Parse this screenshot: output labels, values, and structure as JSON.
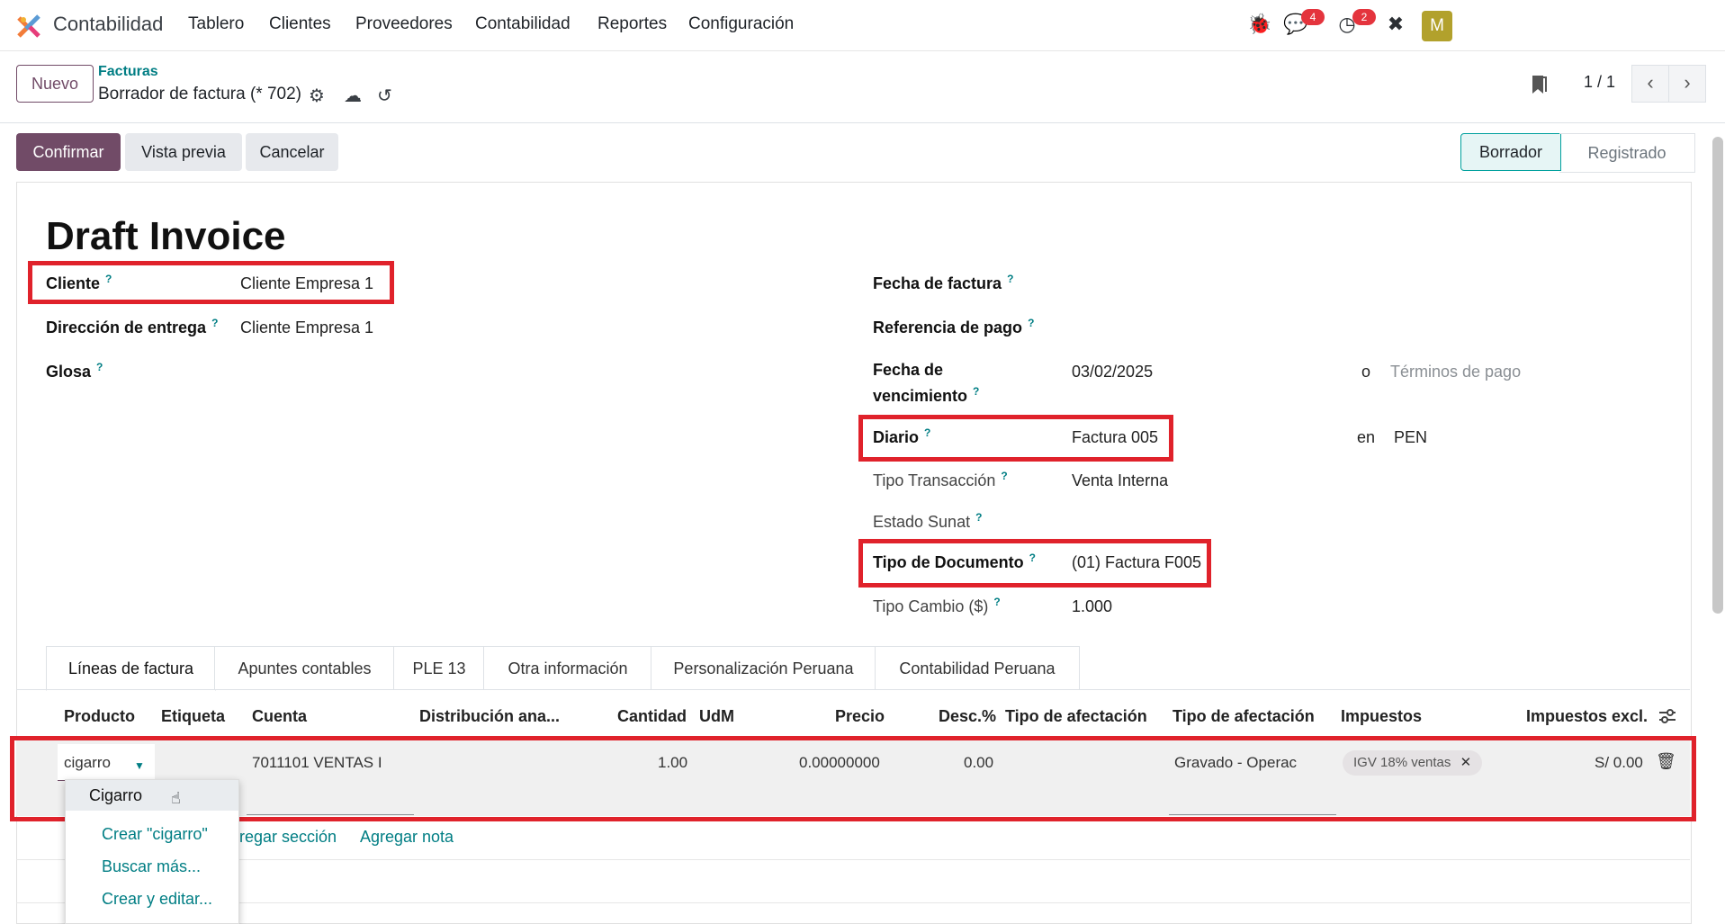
{
  "app": {
    "name": "Contabilidad",
    "menu": [
      "Tablero",
      "Clientes",
      "Proveedores",
      "Contabilidad",
      "Reportes",
      "Configuración"
    ],
    "messages_badge": "4",
    "activities_badge": "2",
    "avatar_initial": "M"
  },
  "control_panel": {
    "new_label": "Nuevo",
    "breadcrumb_parent": "Facturas",
    "breadcrumb_current": "Borrador de factura (* 702)",
    "pager": "1 / 1"
  },
  "actions": {
    "confirm": "Confirmar",
    "preview": "Vista previa",
    "cancel": "Cancelar"
  },
  "status": {
    "current": "Borrador",
    "next": "Registrado"
  },
  "form": {
    "title": "Draft Invoice",
    "left": {
      "cliente_label": "Cliente",
      "cliente_value": "Cliente Empresa 1",
      "direccion_label": "Dirección de entrega",
      "direccion_value": "Cliente Empresa 1",
      "glosa_label": "Glosa"
    },
    "right": {
      "fecha_factura_label": "Fecha de factura",
      "referencia_label": "Referencia de pago",
      "vencimiento_label_1": "Fecha de",
      "vencimiento_label_2": "vencimiento",
      "vencimiento_value": "03/02/2025",
      "or_label": "o",
      "terminos_placeholder": "Términos de pago",
      "diario_label": "Diario",
      "diario_value": "Factura 005",
      "en_label": "en",
      "currency": "PEN",
      "tipo_transaccion_label": "Tipo Transacción",
      "tipo_transaccion_value": "Venta Interna",
      "estado_sunat_label": "Estado Sunat",
      "tipo_documento_label": "Tipo de Documento",
      "tipo_documento_value": "(01) Factura F005",
      "tipo_cambio_label": "Tipo Cambio ($)",
      "tipo_cambio_value": "1.000"
    }
  },
  "tabs": [
    "Líneas de factura",
    "Apuntes contables",
    "PLE 13",
    "Otra información",
    "Personalización Peruana",
    "Contabilidad Peruana"
  ],
  "table": {
    "headers": [
      "Producto",
      "Etiqueta",
      "Cuenta",
      "Distribución ana...",
      "Cantidad",
      "UdM",
      "Precio",
      "Desc.%",
      "Tipo de afectación",
      "Tipo de afectación",
      "Impuestos",
      "Impuestos excl."
    ],
    "row": {
      "producto": "cigarro",
      "cuenta": "7011101 VENTAS I",
      "cantidad": "1.00",
      "precio": "0.00000000",
      "descuento": "0.00",
      "tipo_afectacion": "Gravado - Operac",
      "impuesto": "IGV 18% ventas",
      "subtotal": "S/ 0.00"
    },
    "add_section": "regar sección",
    "add_note": "Agregar nota"
  },
  "dropdown": {
    "option": "Cigarro",
    "create": "Crear \"cigarro\"",
    "search_more": "Buscar más...",
    "create_edit": "Crear y editar..."
  }
}
